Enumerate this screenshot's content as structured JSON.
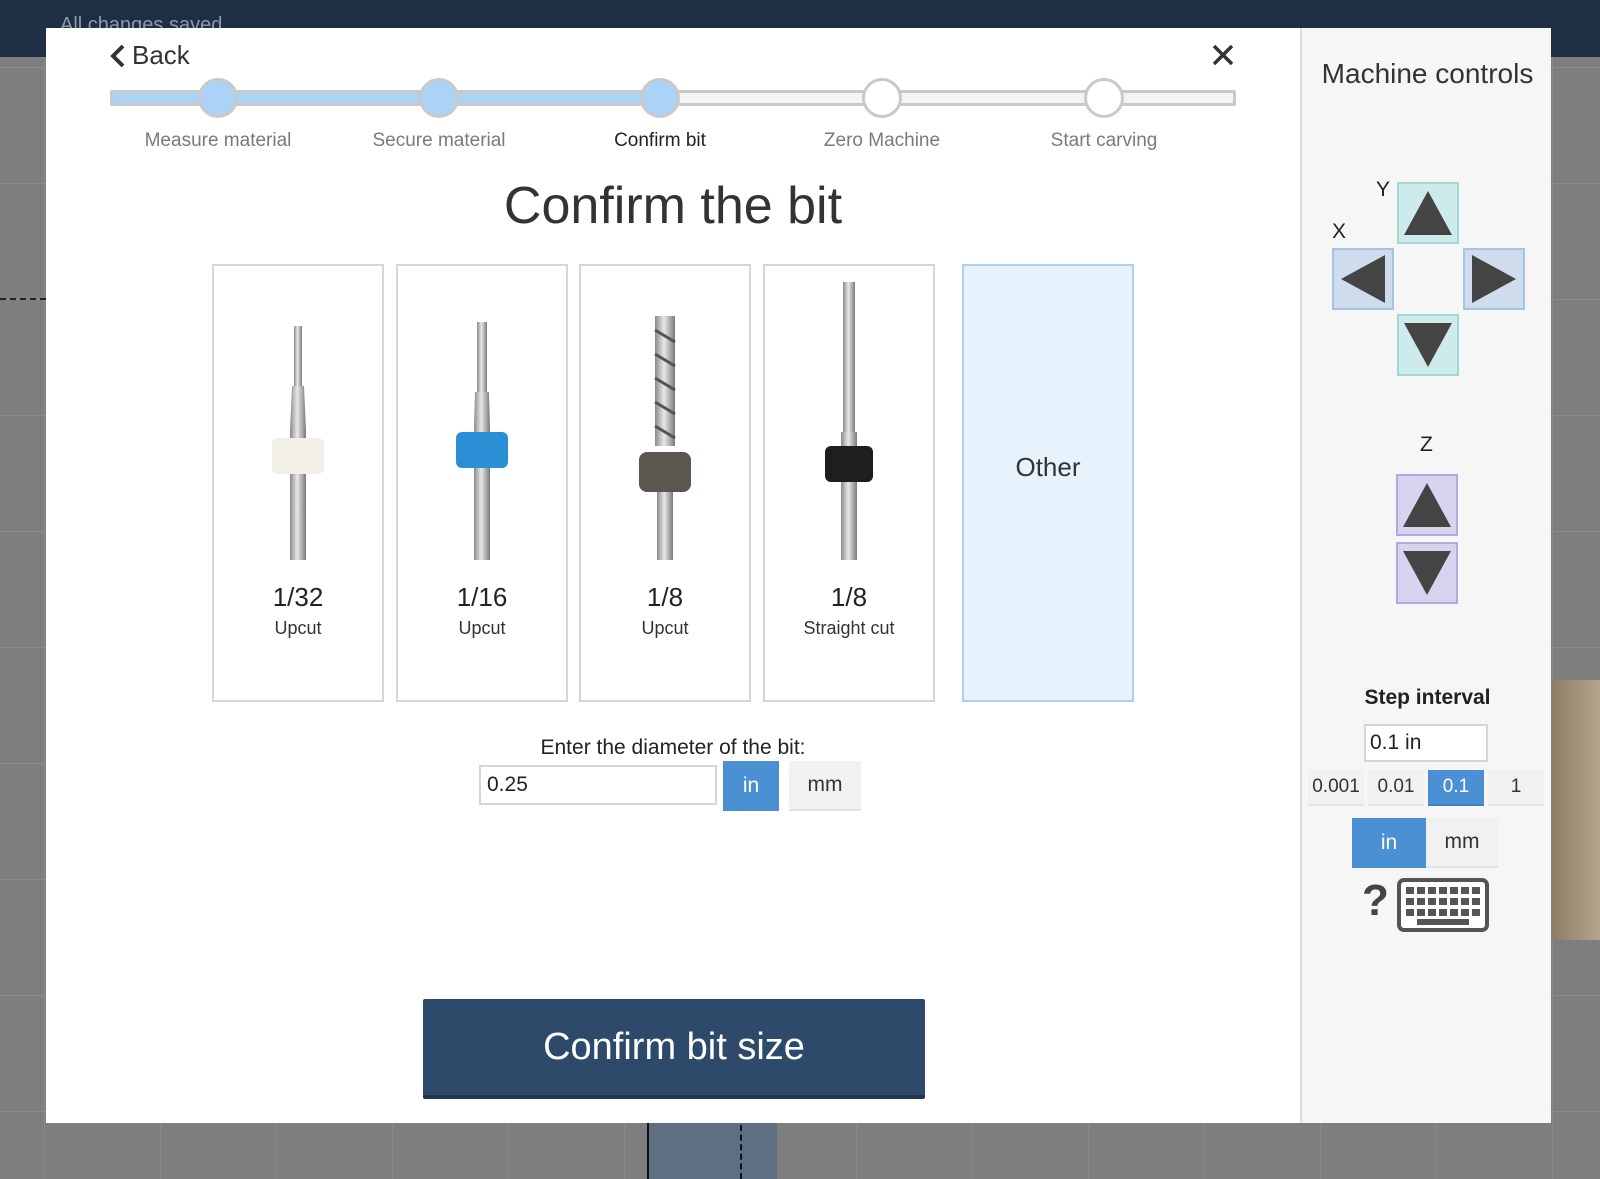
{
  "app": {
    "status_text": "All changes saved"
  },
  "modal": {
    "back_label": "Back",
    "steps": [
      {
        "label": "Measure material",
        "state": "done"
      },
      {
        "label": "Secure material",
        "state": "done"
      },
      {
        "label": "Confirm bit",
        "state": "current"
      },
      {
        "label": "Zero Machine",
        "state": "todo"
      },
      {
        "label": "Start carving",
        "state": "todo"
      }
    ],
    "title": "Confirm the bit",
    "bits": [
      {
        "size": "1/32",
        "type": "Upcut",
        "collar_color": "#f2f0e8"
      },
      {
        "size": "1/16",
        "type": "Upcut",
        "collar_color": "#2b8fd6"
      },
      {
        "size": "1/8",
        "type": "Upcut",
        "collar_color": "#5a5650"
      },
      {
        "size": "1/8",
        "type": "Straight cut",
        "collar_color": "#1e1e1e"
      }
    ],
    "other_label": "Other",
    "diameter_label": "Enter the diameter of the bit:",
    "diameter_value": "0.25",
    "unit_in": "in",
    "unit_mm": "mm",
    "selected_unit": "in",
    "confirm_label": "Confirm bit size"
  },
  "machine_controls": {
    "title": "Machine controls",
    "axis_y": "Y",
    "axis_x": "X",
    "axis_z": "Z",
    "step_interval_label": "Step interval",
    "step_interval_value": "0.1 in",
    "step_options": [
      "0.001",
      "0.01",
      "0.1",
      "1"
    ],
    "selected_step": "0.1",
    "unit_in": "in",
    "unit_mm": "mm",
    "selected_unit": "in",
    "help_label": "?"
  },
  "colors": {
    "accent": "#4a90d2",
    "primary_button": "#2d4a6a",
    "progress_done": "#aad3f7",
    "other_card_bg": "#e6f2fc"
  }
}
